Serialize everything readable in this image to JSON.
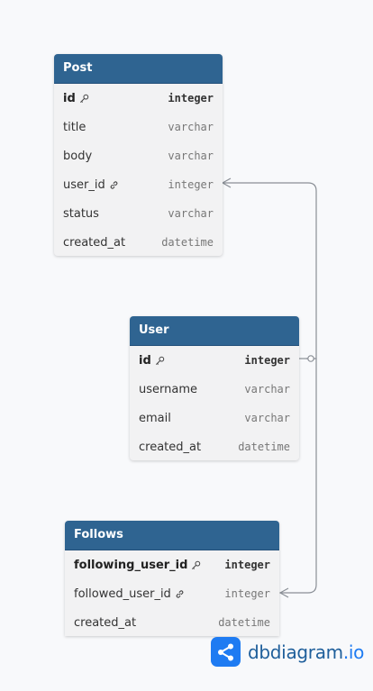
{
  "tables": {
    "post": {
      "name": "Post",
      "columns": [
        {
          "name": "id",
          "type": "integer",
          "key": "primary"
        },
        {
          "name": "title",
          "type": "varchar"
        },
        {
          "name": "body",
          "type": "varchar"
        },
        {
          "name": "user_id",
          "type": "integer",
          "key": "foreign"
        },
        {
          "name": "status",
          "type": "varchar"
        },
        {
          "name": "created_at",
          "type": "datetime"
        }
      ]
    },
    "user": {
      "name": "User",
      "columns": [
        {
          "name": "id",
          "type": "integer",
          "key": "primary"
        },
        {
          "name": "username",
          "type": "varchar"
        },
        {
          "name": "email",
          "type": "varchar"
        },
        {
          "name": "created_at",
          "type": "datetime"
        }
      ]
    },
    "follows": {
      "name": "Follows",
      "columns": [
        {
          "name": "following_user_id",
          "type": "integer",
          "key": "primary"
        },
        {
          "name": "followed_user_id",
          "type": "integer",
          "key": "foreign"
        },
        {
          "name": "created_at",
          "type": "datetime"
        }
      ]
    }
  },
  "relations": [
    {
      "from": "Post.user_id",
      "to": "User.id",
      "type": "many-to-one"
    },
    {
      "from": "Follows.followed_user_id",
      "to": "User.id",
      "type": "many-to-one"
    }
  ],
  "brand": {
    "name_main": "dbdiagram",
    "name_suffix": ".io",
    "accent": "#1e7bf2"
  }
}
